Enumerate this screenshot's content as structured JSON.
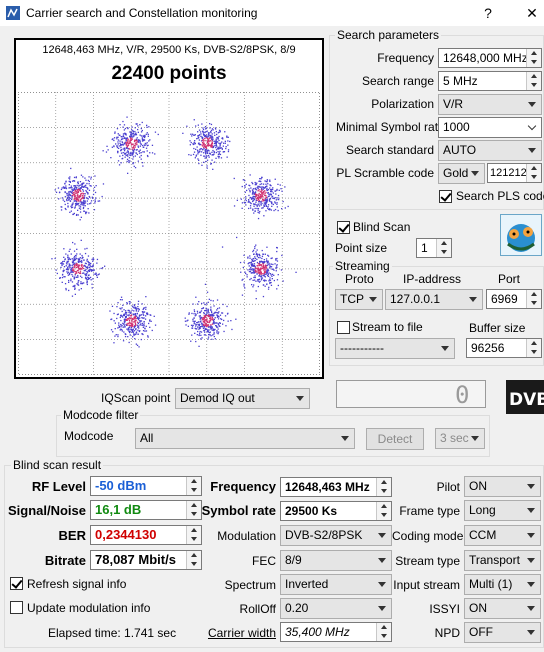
{
  "window": {
    "title": "Carrier search and Constellation monitoring",
    "help": "?",
    "close": "✕"
  },
  "constellation": {
    "info": "12648,463 MHz, V/R, 29500 Ks, DVB-S2/8PSK, 8/9",
    "points": "22400 points"
  },
  "search": {
    "group": "Search parameters",
    "frequency_label": "Frequency",
    "frequency": "12648,000 MHz",
    "range_label": "Search range",
    "range": "5 MHz",
    "pol_label": "Polarization",
    "pol": "V/R",
    "minsr_label": "Minimal Symbol rate",
    "minsr": "1000",
    "std_label": "Search standard",
    "std": "AUTO",
    "pls_label": "PL Scramble code",
    "pls_mode": "Gold",
    "pls_value": "121212",
    "search_pls_label": "Search PLS code"
  },
  "blind": {
    "label": "Blind Scan",
    "point_size_label": "Point size",
    "point_size": "1"
  },
  "streaming": {
    "group": "Streaming",
    "proto_label": "Proto",
    "ip_label": "IP-address",
    "port_label": "Port",
    "proto": "TCP",
    "ip": "127.0.0.1",
    "port": "6969",
    "file_label": "Stream to file",
    "file": "-----------",
    "buffer_label": "Buffer size",
    "buffer": "96256"
  },
  "iq": {
    "label": "IQScan point",
    "value": "Demod IQ out",
    "digit": "0"
  },
  "modcode": {
    "group": "Modcode filter",
    "label": "Modcode",
    "value": "All",
    "detect": "Detect",
    "interval": "3 sec"
  },
  "result": {
    "group": "Blind scan result",
    "rf_label": "RF Level",
    "rf": "-50 dBm",
    "sn_label": "Signal/Noise",
    "sn": "16,1 dB",
    "ber_label": "BER",
    "ber": "0,2344130",
    "bitrate_label": "Bitrate",
    "bitrate": "78,087 Mbit/s",
    "freq_label": "Frequency",
    "freq": "12648,463 MHz",
    "sr_label": "Symbol rate",
    "sr": "29500 Ks",
    "mod_label": "Modulation",
    "mod": "DVB-S2/8PSK",
    "fec_label": "FEC",
    "fec": "8/9",
    "spec_label": "Spectrum",
    "spec": "Inverted",
    "roll_label": "RollOff",
    "roll": "0.20",
    "cw_label": "Carrier width",
    "cw": "35,400 MHz",
    "pilot_label": "Pilot",
    "pilot": "ON",
    "frame_label": "Frame type",
    "frame": "Long",
    "coding_label": "Coding mode",
    "coding": "CCM",
    "stype_label": "Stream type",
    "stype": "Transport",
    "input_label": "Input stream",
    "input": "Multi (1)",
    "issyi_label": "ISSYI",
    "issyi": "ON",
    "npd_label": "NPD",
    "npd": "OFF",
    "refresh_label": "Refresh signal info",
    "update_label": "Update modulation info",
    "elapsed": "Elapsed time: 1.741 sec"
  },
  "colors": {
    "rf": "#1a5fd6",
    "sn": "#118a11",
    "ber": "#d00000",
    "dots": "#4a3fd0",
    "dot_core": "#d03070"
  }
}
